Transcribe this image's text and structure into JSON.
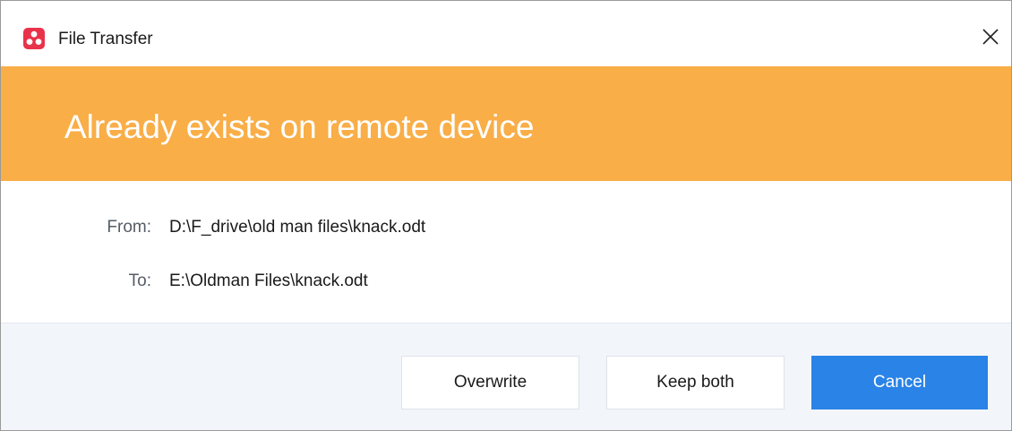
{
  "window": {
    "title": "File Transfer",
    "app_icon": "anydesk-style-logo-icon",
    "close_icon": "close-icon",
    "colors": {
      "app_icon": "#e8334a",
      "banner_bg": "#f9ae48",
      "primary_button": "#2a83e6",
      "footer_bg": "#f2f6fb"
    }
  },
  "banner": {
    "heading": "Already exists on remote device"
  },
  "details": {
    "from_label": "From:",
    "from_path": "D:\\F_drive\\old man files\\knack.odt",
    "to_label": "To:",
    "to_path": "E:\\Oldman Files\\knack.odt"
  },
  "actions": {
    "overwrite": "Overwrite",
    "keep_both": "Keep both",
    "cancel": "Cancel"
  }
}
